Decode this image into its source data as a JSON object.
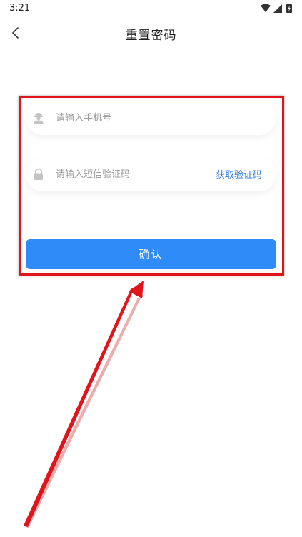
{
  "status_bar": {
    "time": "3:21",
    "icons": [
      "wifi-icon",
      "signal-icon",
      "battery-icon"
    ]
  },
  "app_bar": {
    "title": "重置密码",
    "back_icon": "chevron-left-icon"
  },
  "form": {
    "phone": {
      "placeholder": "请输入手机号",
      "value": "",
      "icon": "user-icon"
    },
    "code": {
      "placeholder": "请输入短信验证码",
      "value": "",
      "icon": "lock-icon",
      "get_code_label": "获取验证码"
    },
    "confirm_label": "确认"
  },
  "colors": {
    "primary": "#2e8bf7",
    "link": "#2a7ad8",
    "annotation": "#e0151b"
  }
}
